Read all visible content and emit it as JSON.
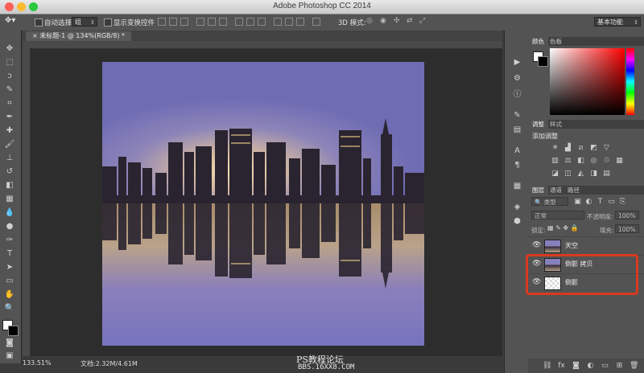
{
  "window": {
    "title": "Adobe Photoshop CC 2014"
  },
  "options_bar": {
    "auto_select_label": "自动选择:",
    "auto_select_value": "组",
    "show_transform_label": "显示变换控件",
    "mode_3d_label": "3D 模式:",
    "workspace_value": "基本功能"
  },
  "document": {
    "tab_title": "未标题-1 @ 134%(RGB/8) *"
  },
  "status": {
    "zoom": "133.51%",
    "doc_size": "文档:2.32M/4.61M"
  },
  "watermark": {
    "line1": "PS教程论坛",
    "line2": "BBS.16XX8.COM"
  },
  "panels": {
    "color": {
      "tabs": [
        "颜色",
        "色板"
      ]
    },
    "adjustments": {
      "tabs": [
        "调整",
        "样式"
      ],
      "heading": "添加调整"
    },
    "layers": {
      "tabs": [
        "图层",
        "通道",
        "路径"
      ],
      "filter_kind": "类型",
      "blend_mode": "正常",
      "opacity_label": "不透明度:",
      "opacity_value": "100%",
      "lock_label": "锁定:",
      "fill_label": "填充:",
      "fill_value": "100%",
      "items": [
        {
          "name": "天空"
        },
        {
          "name": "倒影 拷贝"
        },
        {
          "name": "倒影"
        }
      ]
    }
  },
  "colors": {
    "highlight": "#d93a1e",
    "background": "#3c3c3c"
  }
}
